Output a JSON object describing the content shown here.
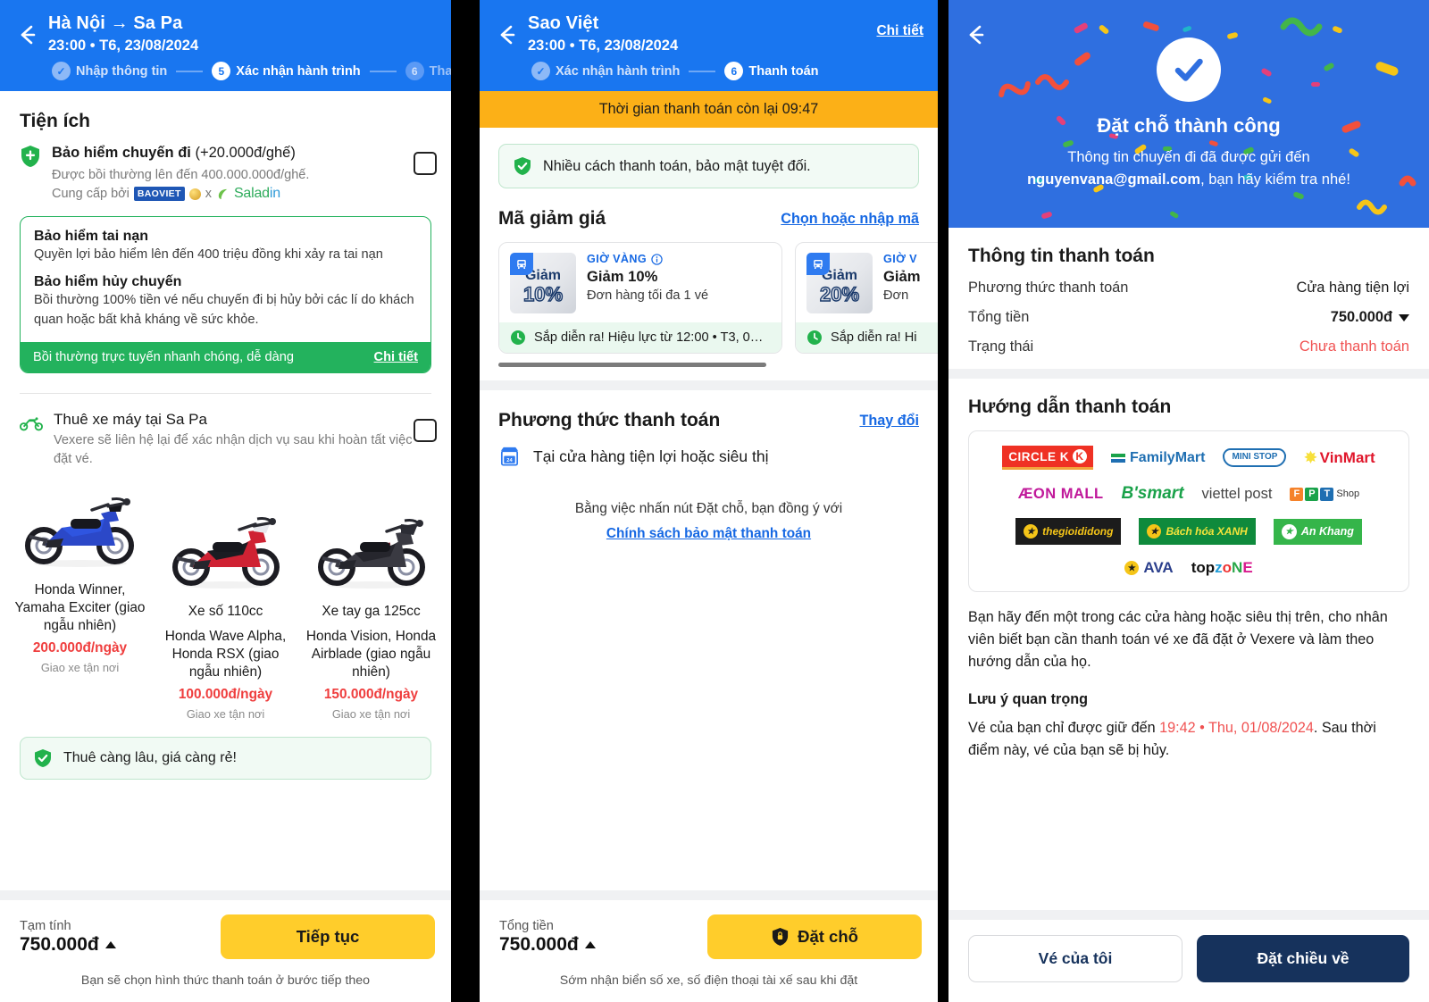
{
  "panel1": {
    "header": {
      "back_icon": "back-arrow-icon",
      "title": "Hà Nội → Sa Pa",
      "subtitle": "23:00 • T6, 23/08/2024",
      "steps": [
        {
          "num": "✓",
          "label": "Nhập thông tin",
          "state": "done"
        },
        {
          "num": "5",
          "label": "Xác nhận hành trình",
          "state": "active"
        },
        {
          "num": "6",
          "label": "Thanh",
          "state": "todo"
        }
      ]
    },
    "section_title": "Tiện ích",
    "insurance": {
      "icon": "shield-icon",
      "title": "Bảo hiểm chuyến đi",
      "title_suffix": "(+20.000đ/ghế)",
      "sub": "Được bồi thường lên đến 400.000.000đ/ghế.",
      "provider_prefix": "Cung cấp bởi",
      "provider_1": "BAOVIET",
      "provider_x": "x",
      "provider_2a": "Salad",
      "provider_2b": "in",
      "checkbox_checked": false
    },
    "benefits": [
      {
        "title": "Bảo hiểm tai nạn",
        "text": "Quyền lợi bảo hiểm lên đến 400 triệu đồng khi xảy ra tai nạn"
      },
      {
        "title": "Bảo hiểm hủy chuyến",
        "text": "Bồi thường 100% tiền vé nếu chuyến đi bị hủy bởi các lí do khách quan hoặc bất khả kháng về sức khỏe."
      }
    ],
    "benefits_footer": {
      "text": "Bồi thường trực tuyến nhanh chóng, dễ dàng",
      "link": "Chi tiết"
    },
    "bike": {
      "icon": "motorbike-icon",
      "title": "Thuê xe máy tại Sa Pa",
      "sub": "Vexere sẽ liên hệ lại để xác nhận dịch vụ sau khi hoàn tất việc đặt vé.",
      "checkbox_checked": false,
      "items": [
        {
          "name": "Honda Winner, Yamaha Exciter (giao ngẫu nhiên)",
          "price": "200.000đ/ngày",
          "note": "Giao xe tận nơi",
          "color": "#2b48c8"
        },
        {
          "name": "Xe số 110cc",
          "name2": "Honda Wave Alpha, Honda RSX (giao ngẫu nhiên)",
          "price": "100.000đ/ngày",
          "note": "Giao xe tận nơi",
          "color": "#cf2233"
        },
        {
          "name": "Xe tay ga 125cc",
          "name2": "Honda Vision, Honda Airblade (giao ngẫu nhiên)",
          "price": "150.000đ/ngày",
          "note": "Giao xe tận nơi",
          "color": "#3a3a42"
        }
      ]
    },
    "tip": {
      "icon": "shield-check-icon",
      "text": "Thuê càng lâu, giá càng rẻ!"
    },
    "footer": {
      "label": "Tạm tính",
      "amount": "750.000đ",
      "caret": "caret-up-icon",
      "button": "Tiếp tục",
      "note": "Bạn sẽ chọn hình thức thanh toán ở bước tiếp theo"
    }
  },
  "panel2": {
    "header": {
      "back_icon": "back-arrow-icon",
      "title": "Sao Việt",
      "subtitle": "23:00 • T6, 23/08/2024",
      "detail_link": "Chi tiết",
      "steps": [
        {
          "num": "✓",
          "label": "Xác nhận hành trình",
          "state": "done"
        },
        {
          "num": "6",
          "label": "Thanh toán",
          "state": "active"
        }
      ]
    },
    "timer": "Thời gian thanh toán còn lại 09:47",
    "secure_note": {
      "icon": "shield-check-icon",
      "text": "Nhiều cách thanh toán, bảo mật tuyệt đối."
    },
    "voucher_section": {
      "title": "Mã giảm giá",
      "link": "Chọn hoặc nhập mã"
    },
    "vouchers": [
      {
        "badge_top": "Giảm",
        "badge_pct": "10%",
        "badge_icon": "bus-icon",
        "kicker": "GIỜ VÀNG",
        "kicker_icon": "info-icon",
        "main": "Giảm 10%",
        "sub": "Đơn hàng tối đa 1 vé",
        "foot_icon": "clock-icon",
        "foot": "Sắp diễn ra! Hiệu lực từ 12:00 • T3, 0…"
      },
      {
        "badge_top": "Giảm",
        "badge_pct": "20%",
        "badge_icon": "bus-icon",
        "kicker": "GIỜ V",
        "kicker_icon": "info-icon",
        "main": "Giảm",
        "sub": "Đơn",
        "foot_icon": "clock-icon",
        "foot": "Sắp diễn ra! Hi"
      }
    ],
    "payment_section": {
      "title": "Phương thức thanh toán",
      "link": "Thay đổi"
    },
    "payment_method": {
      "icon": "store-24-icon",
      "label": "Tại cửa hàng tiện lợi hoặc siêu thị"
    },
    "agree": {
      "text": "Bằng việc nhấn nút Đặt chỗ, bạn đồng ý với",
      "link": "Chính sách bảo mật thanh toán"
    },
    "footer": {
      "label": "Tổng tiền",
      "amount": "750.000đ",
      "caret": "caret-up-icon",
      "button": "Đặt chỗ",
      "button_icon": "shield-icon",
      "note": "Sớm nhận biển số xe, số điện thoại tài xế sau khi đặt"
    }
  },
  "panel3": {
    "back_icon": "back-arrow-icon",
    "success": {
      "check_icon": "check-circle-icon",
      "title": "Đặt chỗ thành công",
      "sub_line1": "Thông tin chuyến đi đã được gửi đến",
      "email": "nguyenvana@gmail.com",
      "sub_line2": ", bạn hãy kiểm tra nhé!"
    },
    "payment_info": {
      "title": "Thông tin thanh toán",
      "rows": [
        {
          "key": "Phương thức thanh toán",
          "value": "Cửa hàng tiện lợi",
          "style": "normal"
        },
        {
          "key": "Tổng tiền",
          "value": "750.000đ",
          "style": "bold"
        },
        {
          "key": "Trạng thái",
          "value": "Chưa thanh toán",
          "style": "red"
        }
      ]
    },
    "guide": {
      "title": "Hướng dẫn thanh toán",
      "logos_row1": [
        "CIRCLE K",
        "FamilyMart",
        "MINI STOP",
        "VinMart"
      ],
      "logos_row2": [
        "ÆON MALL",
        "B'smart",
        "viettel post",
        "FPT Shop"
      ],
      "logos_row3": [
        "thegioididong",
        "Bách hóa XANH",
        "An Khang"
      ],
      "logos_row4": [
        "AVA",
        "topzone"
      ],
      "paragraph": "Bạn hãy đến một trong các cửa hàng hoặc siêu thị trên, cho nhân viên biết bạn cần thanh toán vé xe đã đặt ở Vexere và làm theo hướng dẫn của họ.",
      "note_title": "Lưu ý quan trọng",
      "note_pre": "Vé của bạn chỉ được giữ đến ",
      "note_red": "19:42 • Thu, 01/08/2024",
      "note_post": ". Sau thời điểm này, vé của bạn sẽ bị hủy."
    },
    "footer": {
      "btn_secondary": "Vé của tôi",
      "btn_primary": "Đặt chiều về"
    }
  },
  "colors": {
    "brand_blue": "#1976f0",
    "success_green": "#23b25d",
    "warning_orange": "#fcb017",
    "accent_yellow": "#ffcd2b",
    "danger_red": "#f05252",
    "navy": "#16325c"
  }
}
